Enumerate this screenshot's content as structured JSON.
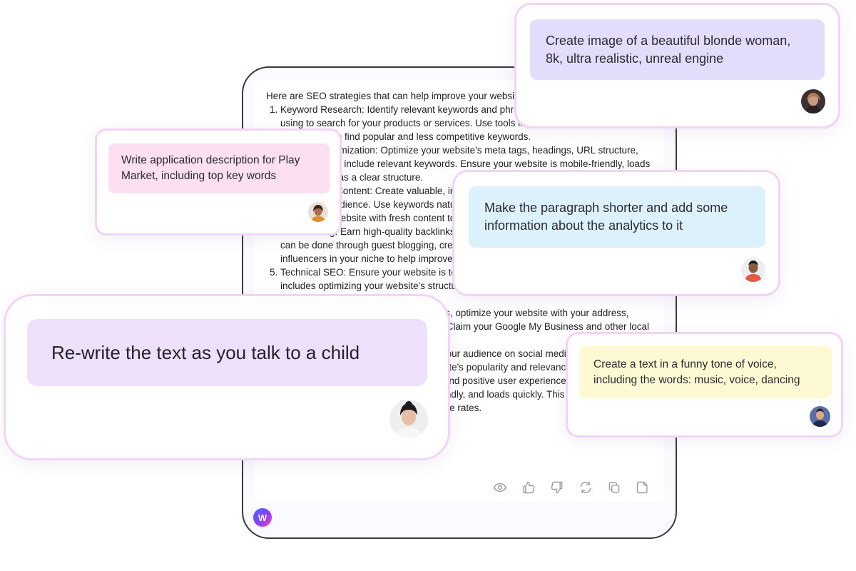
{
  "assistant_answer": {
    "intro": "Here are SEO strategies that can help improve your website's search rankings:",
    "items": [
      "Keyword Research: Identify relevant keywords and phrases your target audience is using to search for your products or services. Use tools like Google Keyword Planner or SEMrush to find popular and less competitive keywords.",
      "On-Page Optimization: Optimize your website's meta tags, headings, URL structure, and content to include relevant keywords. Ensure your website is mobile-friendly, loads quickly, and has a clear structure.",
      "High-Quality Content: Create valuable, informative content that meets the needs of your target audience. Use keywords naturally and avoid keyword stuffing. Regularly update your website with fresh content to attract search engine crawlers.",
      "Link Building: Earn high-quality backlinks from reputable websites in your industry. This can be done through guest blogging, creating shareable content, and reaching out to influencers in your niche to help improve your rankings.",
      "Technical SEO: Ensure your website is technically optimized for search engines. This includes optimizing your website's structure, improving page load speed, and submitting XML sitemaps.",
      "Local SEO: If you have a local business, optimize your website with your address, phone number, and customer reviews. Claim your Google My Business and other local listings.",
      "Social Media Marketing: Engage with your audience on social media platforms. Social signals can indirectly impact your website's popularity and relevance.",
      "User Experience: Provide a seamless and positive user experience. Ensure your website is easy to navigate, mobile-friendly, and loads quickly. This can help improve your search rankings and reduce bounce rates."
    ],
    "actions": [
      {
        "icon": "eye-icon"
      },
      {
        "icon": "thumbs-up-icon"
      },
      {
        "icon": "thumbs-down-icon"
      },
      {
        "icon": "regenerate-icon"
      },
      {
        "icon": "copy-icon"
      },
      {
        "icon": "note-icon"
      }
    ]
  },
  "brand": {
    "logo_letter": "W",
    "icon": "brand-logo-icon"
  },
  "prompts": [
    {
      "id": "pink",
      "text": "Write application description for Play Market, including top key words",
      "bubble_color": "#fddff3",
      "avatar_icon": "user-avatar-icon"
    },
    {
      "id": "violet",
      "text": "Create image of a beautiful blonde woman, 8k, ultra realistic, unreal engine",
      "bubble_color": "#e3ddfb",
      "avatar_icon": "user-avatar-icon"
    },
    {
      "id": "blue",
      "text": "Make the paragraph shorter and add some information about the analytics to it",
      "bubble_color": "#ddf1fc",
      "avatar_icon": "user-avatar-icon"
    },
    {
      "id": "yellow",
      "text": "Create a text in a funny tone of voice, including the words: music, voice, dancing",
      "bubble_color": "#fdf9d3",
      "avatar_icon": "user-avatar-icon"
    },
    {
      "id": "large",
      "text": "Re-write the text as you talk to a child",
      "bubble_color": "#eee0fb",
      "avatar_icon": "user-avatar-icon"
    }
  ],
  "colors": {
    "card_border": "#f1d5f6",
    "device_border": "#3a3a3f",
    "action_icon": "#9a9aa5"
  }
}
